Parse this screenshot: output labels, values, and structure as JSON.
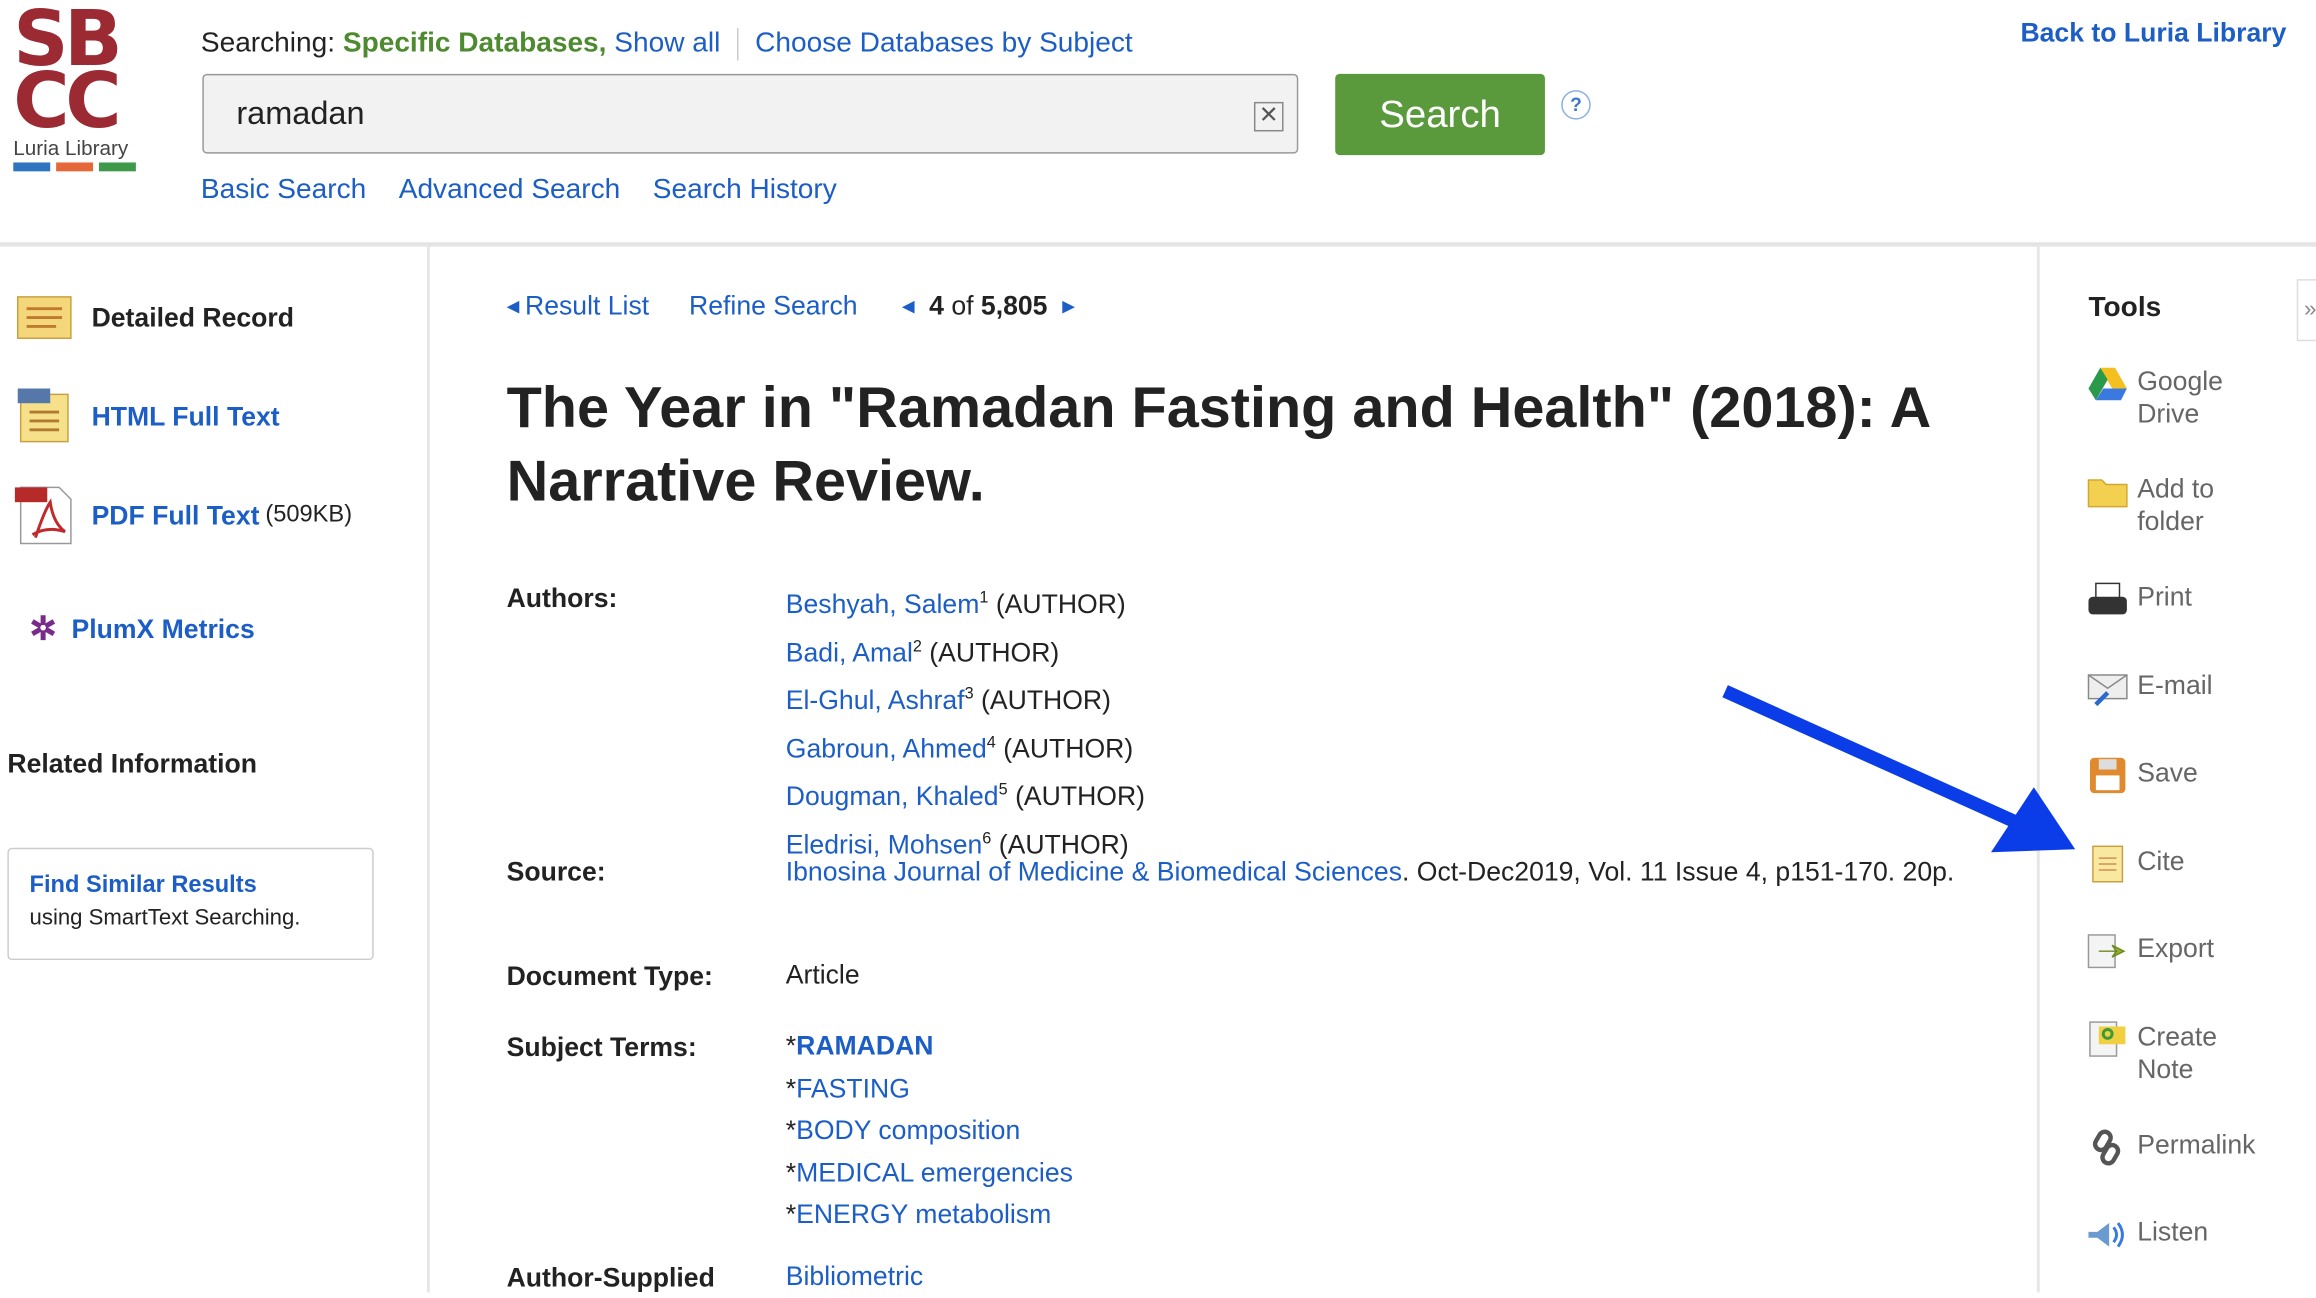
{
  "logo": {
    "letters_top": "SB",
    "letters_bottom": "CC",
    "caption": "Luria Library",
    "stripe_colors": [
      "#2e74c0",
      "#e4683a",
      "#3d9a4a"
    ]
  },
  "header": {
    "searching_label": "Searching:",
    "databases": "Specific Databases,",
    "show_all": "Show all",
    "choose_by_subject": "Choose Databases by Subject",
    "search_value": "ramadan",
    "search_button": "Search",
    "help": "?",
    "back_link": "Back to Luria Library",
    "links": [
      "Basic Search",
      "Advanced Search",
      "Search History"
    ]
  },
  "left": {
    "items": [
      {
        "label": "Detailed Record",
        "icon": "detailed-record-icon"
      },
      {
        "label": "HTML Full Text",
        "icon": "html-icon"
      },
      {
        "label": "PDF Full Text",
        "size": "(509KB)",
        "icon": "pdf-icon"
      },
      {
        "label": "PlumX Metrics",
        "icon": "plumx-icon"
      }
    ],
    "related_title": "Related Information",
    "similar_link": "Find Similar Results",
    "similar_sub": "using SmartText Searching."
  },
  "main": {
    "nav": {
      "result_list": "Result List",
      "refine": "Refine Search",
      "position": "4",
      "of": "of",
      "total": "5,805"
    },
    "title": "The Year in \"Ramadan Fasting and Health\" (2018): A Narrative Review.",
    "authors_label": "Authors:",
    "authors": [
      {
        "name": "Beshyah, Salem",
        "sup": "1",
        "role": "(AUTHOR)"
      },
      {
        "name": "Badi, Amal",
        "sup": "2",
        "role": "(AUTHOR)"
      },
      {
        "name": "El-Ghul, Ashraf",
        "sup": "3",
        "role": "(AUTHOR)"
      },
      {
        "name": "Gabroun, Ahmed",
        "sup": "4",
        "role": "(AUTHOR)"
      },
      {
        "name": "Dougman, Khaled",
        "sup": "5",
        "role": "(AUTHOR)"
      },
      {
        "name": "Eledrisi, Mohsen",
        "sup": "6",
        "role": "(AUTHOR)"
      }
    ],
    "source_label": "Source:",
    "source_journal": "Ibnosina Journal of Medicine & Biomedical Sciences",
    "source_rest": ". Oct-Dec2019, Vol. 11 Issue 4, p151-170. 20p.",
    "doctype_label": "Document Type:",
    "doctype": "Article",
    "subjects_label": "Subject Terms:",
    "subjects": [
      "RAMADAN",
      "FASTING",
      "BODY composition",
      "MEDICAL emergencies",
      "ENERGY metabolism"
    ],
    "author_supplied_label": "Author-Supplied",
    "author_supplied_first": "Bibliometric"
  },
  "tools": {
    "title": "Tools",
    "collapse": "»",
    "items": [
      {
        "label": "Google Drive",
        "icon": "google-drive-icon"
      },
      {
        "label": "Add to folder",
        "icon": "folder-icon"
      },
      {
        "label": "Print",
        "icon": "printer-icon"
      },
      {
        "label": "E-mail",
        "icon": "email-icon"
      },
      {
        "label": "Save",
        "icon": "save-icon"
      },
      {
        "label": "Cite",
        "icon": "cite-icon"
      },
      {
        "label": "Export",
        "icon": "export-icon"
      },
      {
        "label": "Create Note",
        "icon": "note-icon"
      },
      {
        "label": "Permalink",
        "icon": "link-icon"
      },
      {
        "label": "Listen",
        "icon": "speaker-icon"
      }
    ]
  },
  "annotation": {
    "arrow_color": "#0a3de8"
  }
}
